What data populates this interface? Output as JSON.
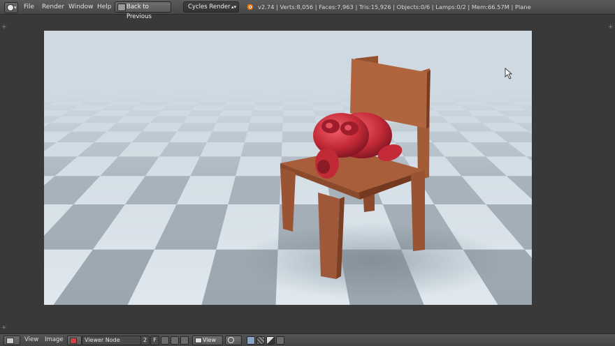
{
  "top_header": {
    "menu": [
      "File",
      "Render",
      "Window",
      "Help"
    ],
    "back_button": "Back to Previous",
    "render_engine": "Cycles Render",
    "stats": "v2.74 | Verts:8,056 | Faces:7,963 | Tris:15,926 | Objects:0/6 | Lamps:0/2 | Mem:66.57M | Plane"
  },
  "viewport": {
    "description_icons": [
      "editor-type-icon",
      "blender-logo-icon"
    ]
  },
  "bottom_header": {
    "menu": [
      "View",
      "Image"
    ],
    "image_name": "Viewer Node",
    "users_count": "2",
    "fake_user": "F",
    "view_menu": "View"
  },
  "colors": {
    "header_bg": "#4e4e4e",
    "area_bg": "#393939",
    "chair": "#a65b38",
    "monkey": "#c8303d",
    "floor_light": "#d9e3ea",
    "floor_dark": "#9aa5ad"
  }
}
